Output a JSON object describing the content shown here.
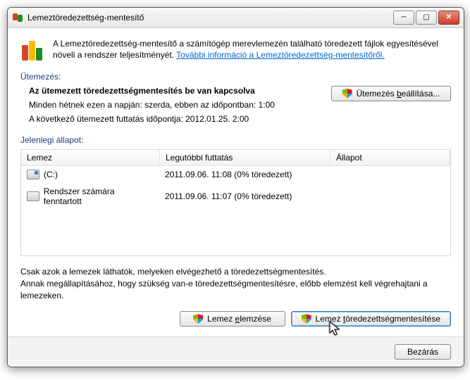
{
  "window": {
    "title": "Lemeztöredezettség-mentesítő"
  },
  "intro": {
    "text": "A Lemeztöredezettség-mentesítő a számítógép merevlemezén található töredezett fájlok egyesítésével növeli a rendszer teljesítményét. ",
    "link": "További információ a Lemeztöredezettség-mentesítőről."
  },
  "schedule": {
    "label": "Ütemezés:",
    "title": "Az ütemezett töredezettségmentesítés be van kapcsolva",
    "line1": "Minden hétnek ezen a napján: szerda, ebben az időpontban: 1:00",
    "line2": "A következő ütemezett futtatás időpontja: 2012.01.25. 2:00",
    "button_before": "Ütemezés ",
    "button_ul": "b",
    "button_after": "eállítása..."
  },
  "status": {
    "label": "Jelenlegi állapot:",
    "headers": {
      "disk": "Lemez",
      "last": "Legutóbbi futtatás",
      "state": "Állapot"
    },
    "rows": [
      {
        "icon": "c",
        "name": "(C:)",
        "last": "2011.09.06. 11:08 (0% töredezett)",
        "state": ""
      },
      {
        "icon": "hdd",
        "name": "Rendszer számára fenntartott",
        "last": "2011.09.06. 11:07 (0% töredezett)",
        "state": ""
      }
    ]
  },
  "note": {
    "line1": "Csak azok a lemezek láthatók, melyeken elvégezhető a töredezettségmentesítés.",
    "line2": "Annak megállapításához, hogy szükség van-e töredezettségmentesítésre, előbb elemzést kell végrehajtani a lemezeken."
  },
  "actions": {
    "analyze_before": "Lemez ",
    "analyze_ul": "e",
    "analyze_after": "lemzése",
    "defrag_before": "Lemez ",
    "defrag_ul": "t",
    "defrag_after": "öredezettségmentesítése"
  },
  "footer": {
    "close": "Bezárás"
  }
}
